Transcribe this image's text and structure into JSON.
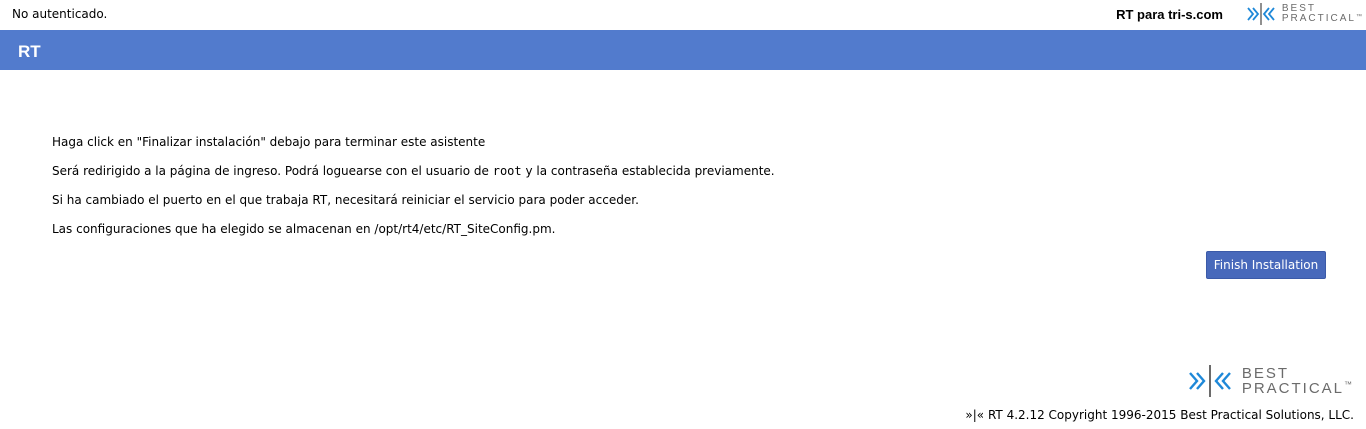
{
  "topbar": {
    "auth_status": "No autenticado.",
    "site_name": "RT para tri-s.com",
    "logo": {
      "line1": "BEST",
      "line2": "PRACTICAL",
      "trademark": "™",
      "icon": "best-practical-logo-icon"
    }
  },
  "header": {
    "title": "RT"
  },
  "main": {
    "line1": "Haga click en \"Finalizar instalación\" debajo para terminar este asistente",
    "line2_before": "Será redirigido a la página de ingreso. Podrá loguearse con el usuario de ",
    "line2_code": "root",
    "line2_after": " y la contraseña establecida previamente.",
    "line3": "Si ha cambiado el puerto en el que trabaja RT, necesitará reiniciar el servicio para poder acceder.",
    "line4": "Las configuraciones que ha elegido se almacenan en /opt/rt4/etc/RT_SiteConfig.pm.",
    "finish_button": "Finish Installation"
  },
  "footer": {
    "logo": {
      "line1": "BEST",
      "line2": "PRACTICAL",
      "trademark": "™"
    },
    "copyright": "»|« RT 4.2.12 Copyright 1996-2015 Best Practical Solutions, LLC."
  },
  "colors": {
    "header_bg": "#527bcd",
    "button_bg": "#4869bb",
    "logo_blue": "#1e88d8",
    "logo_gray": "#6b6b6b"
  }
}
